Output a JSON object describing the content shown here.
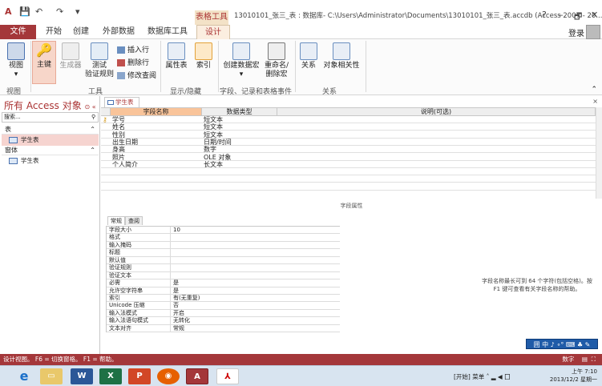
{
  "window": {
    "title": "13010101_张三_表 : 数据库- C:\\Users\\Administrator\\Documents\\13010101_张三_表.accdb (Access 2007 - 20...",
    "context_tab": "表格工具",
    "help": "?",
    "minimize": "–",
    "restore": "🗗",
    "close": "✕"
  },
  "tabs": [
    "文件",
    "开始",
    "创建",
    "外部数据",
    "数据库工具",
    "设计"
  ],
  "login": "登录",
  "ribbon": {
    "view_label": "视图",
    "primary_key_label": "主键",
    "builder_label": "生成器",
    "test_rules_label": "测试\n验证规则",
    "insert_rows": "插入行",
    "delete_rows": "删除行",
    "modify_lookups": "修改查阅",
    "property_sheet": "属性表",
    "indexes": "索引",
    "create_macro": "创建数据宏",
    "rename_macro": "重命名/\n删除宏",
    "relationships": "关系",
    "object_dependencies": "对象相关性",
    "groups": [
      "视图",
      "工具",
      "显示/隐藏",
      "字段、记录和表格事件",
      "关系"
    ]
  },
  "nav": {
    "title": "所有 Access 对象",
    "search_placeholder": "搜索...",
    "sections": [
      {
        "label": "表",
        "items": [
          "学生表"
        ]
      },
      {
        "label": "窗体",
        "items": [
          "学生表"
        ]
      }
    ]
  },
  "document": {
    "tab": "学生表",
    "headers": [
      "字段名称",
      "数据类型",
      "说明(可选)"
    ],
    "fields": [
      {
        "name": "学号",
        "type": "短文本"
      },
      {
        "name": "姓名",
        "type": "短文本"
      },
      {
        "name": "性别",
        "type": "短文本"
      },
      {
        "name": "出生日期",
        "type": "日期/时间"
      },
      {
        "name": "身高",
        "type": "数字"
      },
      {
        "name": "照片",
        "type": "OLE 对象"
      },
      {
        "name": "个人简介",
        "type": "长文本"
      }
    ],
    "properties_label": "字段属性",
    "property_tabs": [
      "常规",
      "查阅"
    ],
    "properties": [
      {
        "key": "字段大小",
        "value": "10"
      },
      {
        "key": "格式",
        "value": ""
      },
      {
        "key": "输入掩码",
        "value": ""
      },
      {
        "key": "标题",
        "value": ""
      },
      {
        "key": "默认值",
        "value": ""
      },
      {
        "key": "验证规则",
        "value": ""
      },
      {
        "key": "验证文本",
        "value": ""
      },
      {
        "key": "必需",
        "value": "是"
      },
      {
        "key": "允许空字符串",
        "value": "是"
      },
      {
        "key": "索引",
        "value": "有(无重复)"
      },
      {
        "key": "Unicode 压缩",
        "value": "否"
      },
      {
        "key": "输入法模式",
        "value": "开启"
      },
      {
        "key": "输入法语句模式",
        "value": "无转化"
      },
      {
        "key": "文本对齐",
        "value": "常规"
      }
    ],
    "help_text": "字段名称最长可到 64 个字符(包括空格)。按 F1 键可查看有关字段名称的帮助。",
    "ime": "囲 中 ♪ ∘° ⌨ ♣ ✎"
  },
  "status": {
    "text": "设计视图。 F6 = 切换窗格。 F1 = 帮助。",
    "right": "数字"
  },
  "taskbar": {
    "ime_mode": "[开始] 菜单",
    "time": "上午 7:10",
    "date": "2013/12/2 星期一"
  },
  "colors": {
    "accent": "#a4373a",
    "context": "#f3e2c7"
  }
}
